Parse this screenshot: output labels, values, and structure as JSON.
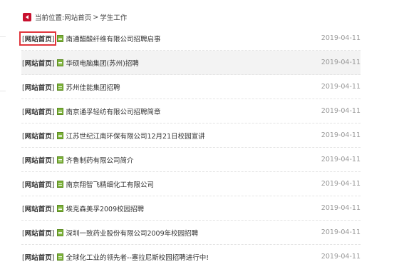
{
  "breadcrumb": {
    "label": "当前位置:",
    "home": "网站首页",
    "separator": ">",
    "current": "学生工作"
  },
  "colors": {
    "accent_red": "#c8102e",
    "highlight_outline": "#e0353b",
    "doc_icon_green": "#7db33a",
    "date_gray": "#999999"
  },
  "articles": [
    {
      "category": "网站首页",
      "title": "南通醋酸纤维有限公司招聘启事",
      "date": "2019-04-11"
    },
    {
      "category": "网站首页",
      "title": "华硕电脑集团(苏州)招聘",
      "date": "2019-04-11"
    },
    {
      "category": "网站首页",
      "title": "苏州佳能集团招聘",
      "date": "2019-04-11"
    },
    {
      "category": "网站首页",
      "title": "南京通孚轻纺有限公司招聘简章",
      "date": "2019-04-11"
    },
    {
      "category": "网站首页",
      "title": "江苏世纪江南环保有限公司12月21日校园宣讲",
      "date": "2019-04-11"
    },
    {
      "category": "网站首页",
      "title": "齐鲁制药有限公司简介",
      "date": "2019-04-11"
    },
    {
      "category": "网站首页",
      "title": "南京翔智飞精细化工有限公司",
      "date": "2019-04-11"
    },
    {
      "category": "网站首页",
      "title": "埃克森美孚2009校园招聘",
      "date": "2019-04-11"
    },
    {
      "category": "网站首页",
      "title": "深圳一致药业股份有限公司2009年校园招聘",
      "date": "2019-04-11"
    },
    {
      "category": "网站首页",
      "title": "全球化工业的领先者--塞拉尼斯校园招聘进行中!",
      "date": "2019-04-11"
    }
  ]
}
